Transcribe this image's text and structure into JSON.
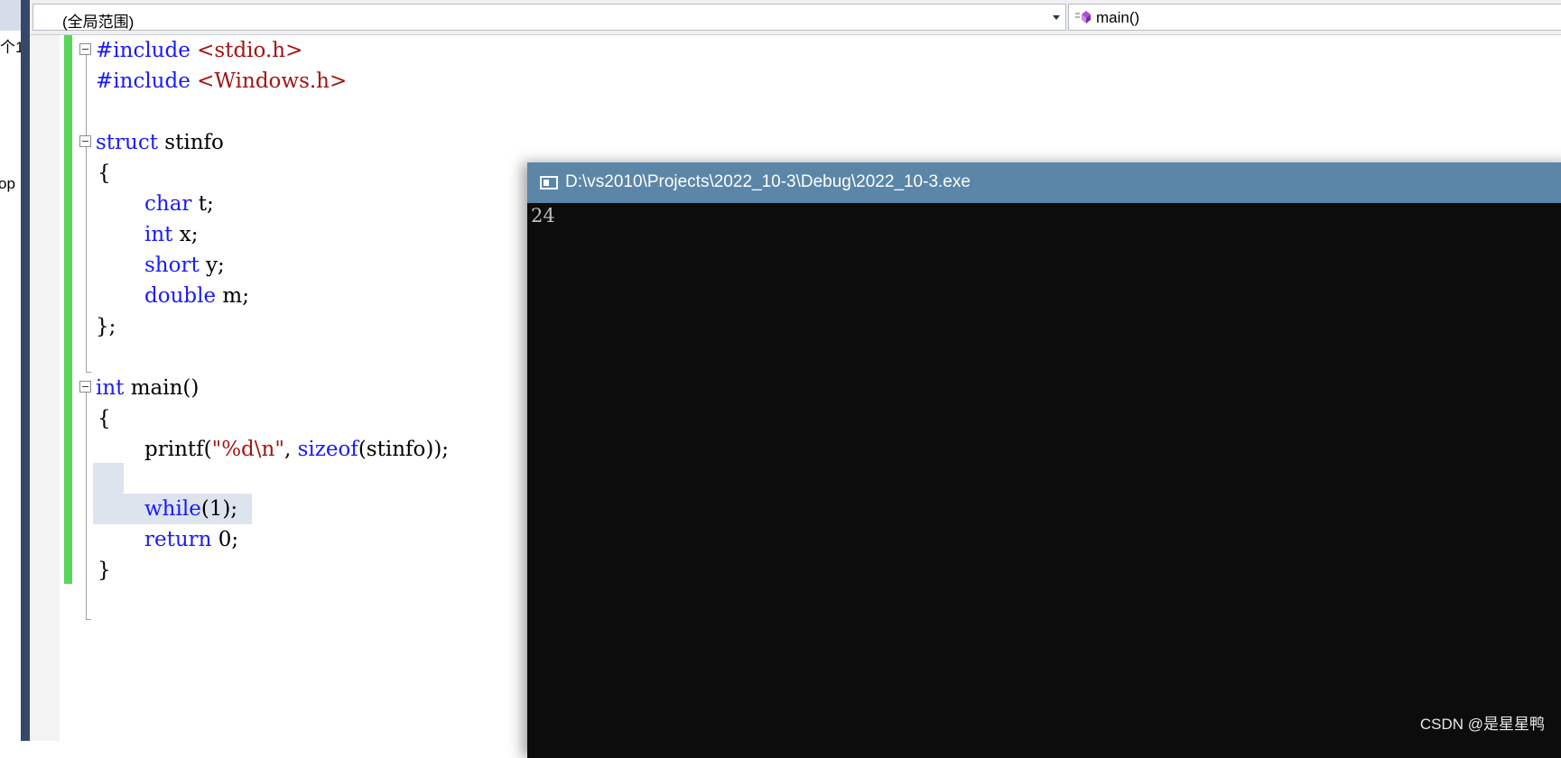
{
  "left_panel": {
    "fragment_1": "个1",
    "fragment_2": "op"
  },
  "navbar": {
    "scope_label": "(全局范围)",
    "member_label": "main()",
    "member_icon": "method-icon"
  },
  "code": {
    "lines": [
      {
        "a": "#include",
        "b": " <stdio.h>"
      },
      {
        "a": "#include",
        "b": " <Windows.h>"
      },
      {
        "a": "struct",
        "b": " stinfo"
      },
      {
        "a": "{"
      },
      {
        "kw": "char",
        "rest": " t;"
      },
      {
        "kw": "int",
        "rest": " x;"
      },
      {
        "kw": "short",
        "rest": " y;"
      },
      {
        "kw": "double",
        "rest": " m;"
      },
      {
        "a": "};"
      },
      {
        "kw": "int",
        "rest": " main()"
      },
      {
        "a": "{"
      },
      {
        "p1": "printf(",
        "s": "\"%d\\n\"",
        "p2": ", ",
        "kw": "sizeof",
        "p3": "(stinfo));"
      },
      {
        "kw": "while",
        "rest": "(1);"
      },
      {
        "kw": "return",
        "rest": " 0;"
      },
      {
        "a": "}"
      }
    ]
  },
  "console": {
    "title": "D:\\vs2010\\Projects\\2022_10-3\\Debug\\2022_10-3.exe",
    "output": "24"
  },
  "watermark": "CSDN @是星星鸭",
  "colors": {
    "keyword": "#1a1aff",
    "string": "#a31515",
    "change_bar": "#57d657",
    "console_title": "#5b86a8"
  }
}
